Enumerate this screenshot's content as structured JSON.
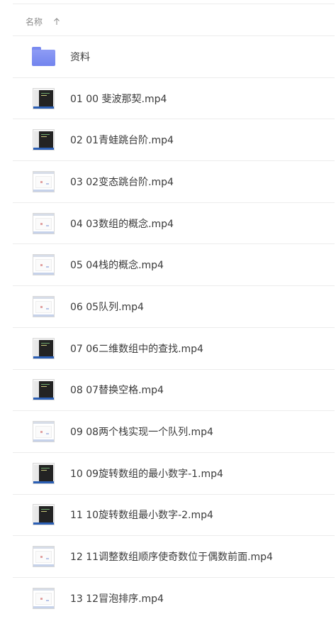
{
  "header": {
    "name_label": "名称",
    "sort_icon": "arrow-up-icon"
  },
  "files": [
    {
      "name": "资料",
      "type": "folder",
      "icon": "folder-icon"
    },
    {
      "name": "01 00 斐波那契.mp4",
      "type": "video",
      "thumb": "dark"
    },
    {
      "name": "02 01青蛙跳台阶.mp4",
      "type": "video",
      "thumb": "dark"
    },
    {
      "name": "03 02变态跳台阶.mp4",
      "type": "video",
      "thumb": "light"
    },
    {
      "name": "04 03数组的概念.mp4",
      "type": "video",
      "thumb": "light"
    },
    {
      "name": "05 04栈的概念.mp4",
      "type": "video",
      "thumb": "light"
    },
    {
      "name": "06 05队列.mp4",
      "type": "video",
      "thumb": "light"
    },
    {
      "name": "07 06二维数组中的查找.mp4",
      "type": "video",
      "thumb": "dark"
    },
    {
      "name": "08 07替换空格.mp4",
      "type": "video",
      "thumb": "dark"
    },
    {
      "name": "09 08两个栈实现一个队列.mp4",
      "type": "video",
      "thumb": "light"
    },
    {
      "name": "10 09旋转数组的最小数字-1.mp4",
      "type": "video",
      "thumb": "dark"
    },
    {
      "name": "11 10旋转数组最小数字-2.mp4",
      "type": "video",
      "thumb": "dark"
    },
    {
      "name": "12 11调整数组顺序使奇数位于偶数前面.mp4",
      "type": "video",
      "thumb": "light"
    },
    {
      "name": "13 12冒泡排序.mp4",
      "type": "video",
      "thumb": "light"
    }
  ]
}
